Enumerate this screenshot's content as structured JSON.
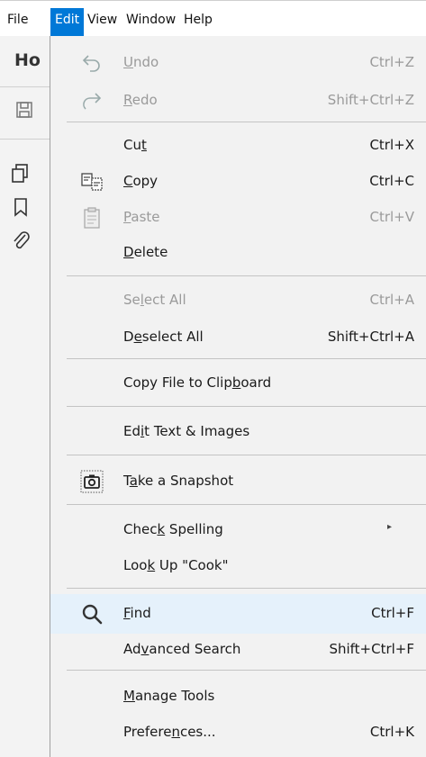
{
  "menubar": {
    "items": [
      {
        "label": "File"
      },
      {
        "label": "Edit"
      },
      {
        "label": "View"
      },
      {
        "label": "Window"
      },
      {
        "label": "Help"
      }
    ],
    "active_color": "#0078d7"
  },
  "app": {
    "home_tab": "Ho"
  },
  "menu": {
    "undo": {
      "pre": "",
      "key": "U",
      "post": "ndo",
      "shortcut": "Ctrl+Z"
    },
    "redo": {
      "pre": "",
      "key": "R",
      "post": "edo",
      "shortcut": "Shift+Ctrl+Z"
    },
    "cut": {
      "pre": "Cu",
      "key": "t",
      "post": "",
      "shortcut": "Ctrl+X"
    },
    "copy": {
      "pre": "",
      "key": "C",
      "post": "opy",
      "shortcut": "Ctrl+C"
    },
    "paste": {
      "pre": "",
      "key": "P",
      "post": "aste",
      "shortcut": "Ctrl+V"
    },
    "delete": {
      "pre": "",
      "key": "D",
      "post": "elete"
    },
    "select_all": {
      "pre": "Se",
      "key": "l",
      "post": "ect All",
      "shortcut": "Ctrl+A"
    },
    "deselect_all": {
      "pre": "D",
      "key": "e",
      "post": "select All",
      "shortcut": "Shift+Ctrl+A"
    },
    "copy_file": {
      "pre": "Copy File to Clip",
      "key": "b",
      "post": "oard"
    },
    "edit_text": {
      "pre": "Ed",
      "key": "i",
      "post": "t Text & Images"
    },
    "snapshot": {
      "pre": "T",
      "key": "a",
      "post": "ke a Snapshot"
    },
    "check_spelling": {
      "pre": "Chec",
      "key": "k",
      "post": " Spelling",
      "arrow": "▸"
    },
    "look_up": {
      "pre": "Loo",
      "key": "k",
      "post": " Up \"Cook\""
    },
    "find": {
      "pre": "",
      "key": "F",
      "post": "ind",
      "shortcut": "Ctrl+F"
    },
    "advanced_search": {
      "pre": "Ad",
      "key": "v",
      "post": "anced Search",
      "shortcut": "Shift+Ctrl+F"
    },
    "manage_tools": {
      "pre": "",
      "key": "M",
      "post": "anage Tools"
    },
    "preferences": {
      "pre": "Prefere",
      "key": "n",
      "post": "ces...",
      "shortcut": "Ctrl+K"
    }
  }
}
